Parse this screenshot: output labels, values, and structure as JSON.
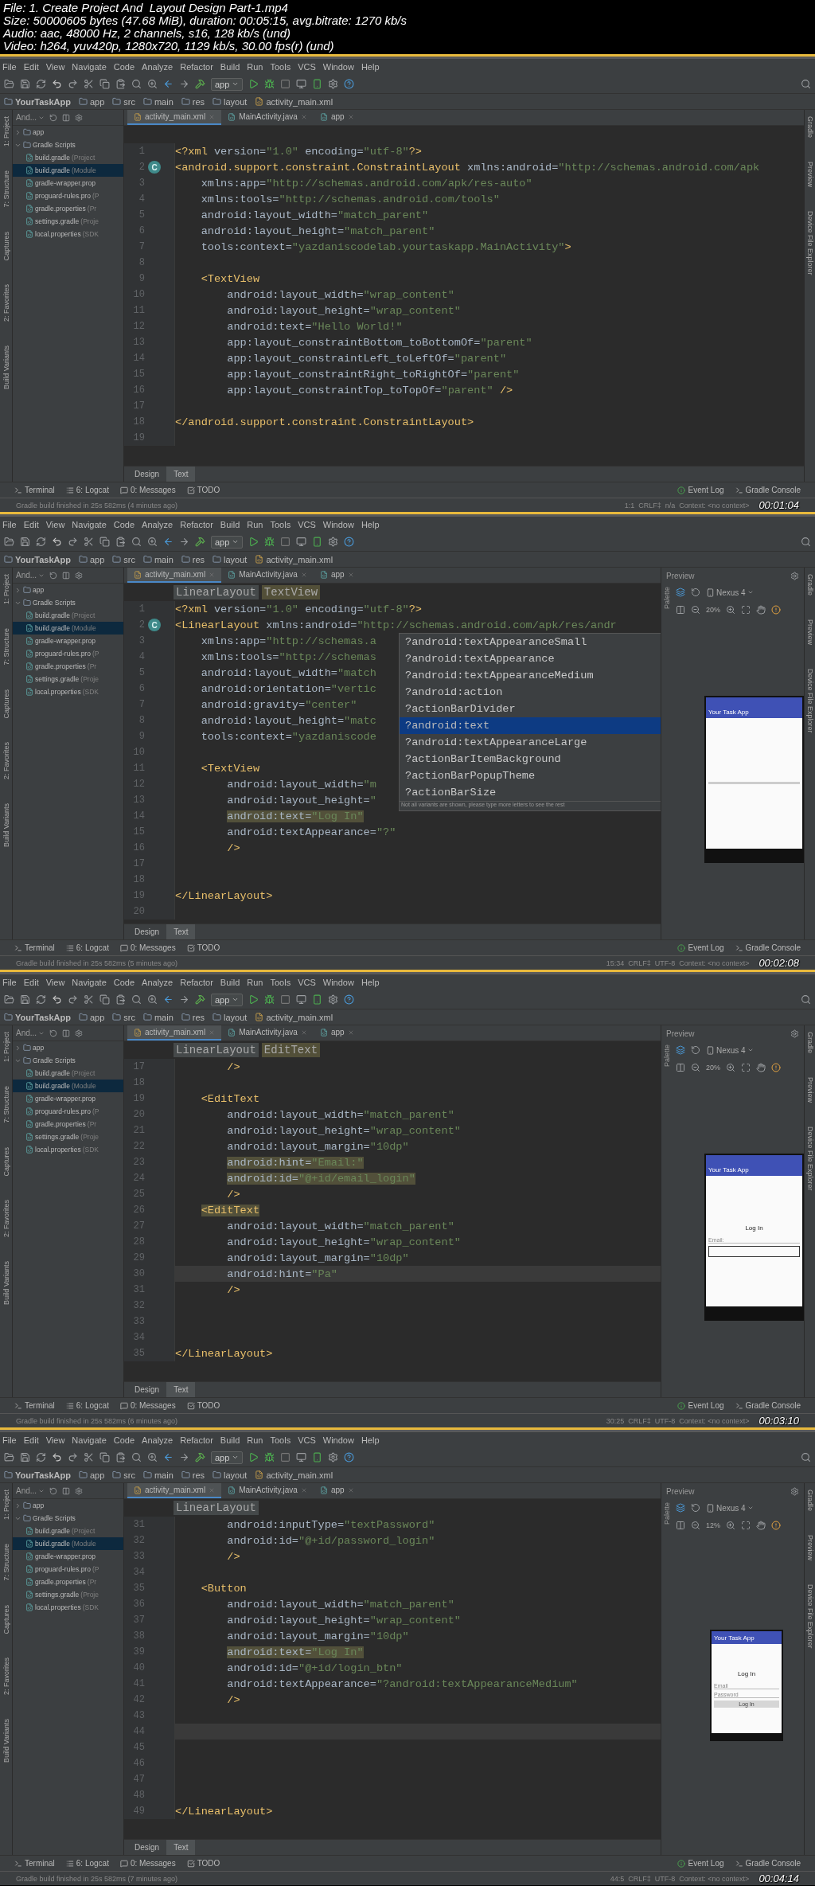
{
  "video_info": [
    "File: 1. Create Project And  Layout Design Part-1.mp4",
    "Size: 50000605 bytes (47.68 MiB), duration: 00:05:15, avg.bitrate: 1270 kb/s",
    "Audio: aac, 48000 Hz, 2 channels, s16, 128 kb/s (und)",
    "Video: h264, yuv420p, 1280x720, 1129 kb/s, 30.00 fps(r) (und)"
  ],
  "frames": [
    {
      "menu": [
        "File",
        "Edit",
        "View",
        "Navigate",
        "Code",
        "Analyze",
        "Refactor",
        "Build",
        "Run",
        "Tools",
        "VCS",
        "Window",
        "Help"
      ],
      "run_config": "app",
      "breadcrumb": [
        "YourTaskApp",
        "app",
        "src",
        "main",
        "res",
        "layout",
        "activity_main.xml"
      ],
      "left_tool_windows": [
        "1: Project",
        "7: Structure",
        "Captures",
        "2: Favorites",
        "Build Variants"
      ],
      "right_tool_windows": [
        "Gradle",
        "Preview",
        "Device File Explorer"
      ],
      "project": {
        "view": "And...",
        "tree": [
          {
            "label": "app",
            "expanded": false,
            "selected": false
          },
          {
            "label": "Gradle Scripts",
            "expanded": true,
            "selected": false,
            "children": [
              {
                "label": "build.gradle",
                "note": "(Project",
                "selected": false
              },
              {
                "label": "build.gradle",
                "note": "(Module",
                "selected": true
              },
              {
                "label": "gradle-wrapper.prop",
                "selected": false
              },
              {
                "label": "proguard-rules.pro",
                "note": "(P",
                "selected": false
              },
              {
                "label": "gradle.properties",
                "note": "(Pr",
                "selected": false
              },
              {
                "label": "settings.gradle",
                "note": "(Proje",
                "selected": false
              },
              {
                "label": "local.properties",
                "note": "(SDK",
                "selected": false
              }
            ]
          }
        ]
      },
      "editor_tabs": [
        {
          "label": "activity_main.xml",
          "selected": true
        },
        {
          "label": "MainActivity.java",
          "selected": false
        },
        {
          "label": "app",
          "selected": false
        }
      ],
      "code_lines": [
        {
          "n": "1",
          "text": "<?xml version=\"1.0\" encoding=\"utf-8\"?>"
        },
        {
          "n": "2",
          "text": "<android.support.constraint.ConstraintLayout xmlns:android=\"http://schemas.android.com/apk",
          "marker": "C"
        },
        {
          "n": "3",
          "text": "    xmlns:app=\"http://schemas.android.com/apk/res-auto\""
        },
        {
          "n": "4",
          "text": "    xmlns:tools=\"http://schemas.android.com/tools\""
        },
        {
          "n": "5",
          "text": "    android:layout_width=\"match_parent\""
        },
        {
          "n": "6",
          "text": "    android:layout_height=\"match_parent\""
        },
        {
          "n": "7",
          "text": "    tools:context=\"yazdaniscodelab.yourtaskapp.MainActivity\">"
        },
        {
          "n": "8"
        },
        {
          "n": "9",
          "text": "    <TextView"
        },
        {
          "n": "10",
          "text": "        android:layout_width=\"wrap_content\""
        },
        {
          "n": "11",
          "text": "        android:layout_height=\"wrap_content\""
        },
        {
          "n": "12",
          "text": "        android:text=\"Hello World!\""
        },
        {
          "n": "13",
          "text": "        app:layout_constraintBottom_toBottomOf=\"parent\""
        },
        {
          "n": "14",
          "text": "        app:layout_constraintLeft_toLeftOf=\"parent\""
        },
        {
          "n": "15",
          "text": "        app:layout_constraintRight_toRightOf=\"parent\""
        },
        {
          "n": "16",
          "text": "        app:layout_constraintTop_toTopOf=\"parent\" />"
        },
        {
          "n": "17"
        },
        {
          "n": "18",
          "text": "</android.support.constraint.ConstraintLayout>"
        },
        {
          "n": "19"
        }
      ],
      "design_tabs": [
        {
          "label": "Design",
          "selected": false
        },
        {
          "label": "Text",
          "selected": true
        }
      ],
      "bottom_tools": [
        "Terminal",
        "6: Logcat",
        "0: Messages",
        "TODO"
      ],
      "bottom_tools_right": [
        "Event Log",
        "Gradle Console"
      ],
      "status": "Gradle build finished in 25s 582ms (4 minutes ago)",
      "status_right": "1:1  CRLF‡  n/a  Context: <no context>",
      "timestamp": "00:01:04"
    },
    {
      "menu": [
        "File",
        "Edit",
        "View",
        "Navigate",
        "Code",
        "Analyze",
        "Refactor",
        "Build",
        "Run",
        "Tools",
        "VCS",
        "Window",
        "Help"
      ],
      "run_config": "app",
      "breadcrumb": [
        "YourTaskApp",
        "app",
        "src",
        "main",
        "res",
        "layout",
        "activity_main.xml"
      ],
      "left_tool_windows": [
        "1: Project",
        "7: Structure",
        "Captures",
        "2: Favorites",
        "Build Variants"
      ],
      "right_tool_windows": [
        "Gradle",
        "Preview",
        "Device File Explorer"
      ],
      "project": {
        "view": "And...",
        "tree": [
          {
            "label": "app",
            "expanded": false,
            "selected": false
          },
          {
            "label": "Gradle Scripts",
            "expanded": true,
            "selected": false,
            "children": [
              {
                "label": "build.gradle",
                "note": "(Project",
                "selected": false
              },
              {
                "label": "build.gradle",
                "note": "(Module",
                "selected": true
              },
              {
                "label": "gradle-wrapper.prop",
                "selected": false
              },
              {
                "label": "proguard-rules.pro",
                "note": "(P",
                "selected": false
              },
              {
                "label": "gradle.properties",
                "note": "(Pr",
                "selected": false
              },
              {
                "label": "settings.gradle",
                "note": "(Proje",
                "selected": false
              },
              {
                "label": "local.properties",
                "note": "(SDK",
                "selected": false
              }
            ]
          }
        ]
      },
      "editor_tabs": [
        {
          "label": "activity_main.xml",
          "selected": true
        },
        {
          "label": "MainActivity.java",
          "selected": false
        },
        {
          "label": "app",
          "selected": false
        }
      ],
      "element_path": [
        "LinearLayout",
        "TextView"
      ],
      "code_lines": [
        {
          "n": "1",
          "text": "<?xml version=\"1.0\" encoding=\"utf-8\"?>"
        },
        {
          "n": "2",
          "text": "<LinearLayout xmlns:android=\"http://schemas.android.com/apk/res/andr",
          "marker": "C"
        },
        {
          "n": "3",
          "text": "    xmlns:app=\"http://schemas.a"
        },
        {
          "n": "4",
          "text": "    xmlns:tools=\"http://schemas"
        },
        {
          "n": "5",
          "text": "    android:layout_width=\"match"
        },
        {
          "n": "6",
          "text": "    android:orientation=\"vertic"
        },
        {
          "n": "7",
          "text": "    android:gravity=\"center\""
        },
        {
          "n": "8",
          "text": "    android:layout_height=\"matc"
        },
        {
          "n": "9",
          "text": "    tools:context=\"yazdaniscode"
        },
        {
          "n": "10"
        },
        {
          "n": "11",
          "text": "    <TextView"
        },
        {
          "n": "12",
          "text": "        android:layout_width=\"m"
        },
        {
          "n": "13",
          "text": "        android:layout_height=\""
        },
        {
          "n": "14",
          "text": "        android:text=\"Log In\"",
          "highlighted": true
        },
        {
          "n": "15",
          "text": "        android:textAppearance=\"?\""
        },
        {
          "n": "16",
          "text": "        />"
        },
        {
          "n": "17"
        },
        {
          "n": "18"
        },
        {
          "n": "19",
          "text": "</LinearLayout>"
        },
        {
          "n": "20"
        }
      ],
      "completion": {
        "items": [
          {
            "label": "?android:textAppearanceSmall",
            "selected": false
          },
          {
            "label": "?android:textAppearance",
            "selected": false
          },
          {
            "label": "?android:textAppearanceMedium",
            "selected": false
          },
          {
            "label": "?android:action",
            "selected": false
          },
          {
            "label": "?actionBarDivider",
            "selected": false
          },
          {
            "label": "?android:text",
            "selected": true
          },
          {
            "label": "?android:textAppearanceLarge",
            "selected": false
          },
          {
            "label": "?actionBarItemBackground",
            "selected": false
          },
          {
            "label": "?actionBarPopupTheme",
            "selected": false
          },
          {
            "label": "?actionBarSize",
            "selected": false
          }
        ],
        "footer": "Not all variants are shown, please type more letters to see the rest"
      },
      "preview": {
        "title": "Preview",
        "side_tab": "Palette",
        "device": "Nexus 4",
        "zoom": "20%",
        "phone": {
          "compact": false,
          "app_title": "Your Task App",
          "content": [
            {
              "kind": "divider"
            }
          ]
        }
      },
      "design_tabs": [
        {
          "label": "Design",
          "selected": false
        },
        {
          "label": "Text",
          "selected": true
        }
      ],
      "bottom_tools": [
        "Terminal",
        "6: Logcat",
        "0: Messages",
        "TODO"
      ],
      "bottom_tools_right": [
        "Event Log",
        "Gradle Console"
      ],
      "status": "Gradle build finished in 25s 582ms (5 minutes ago)",
      "status_right": "15:34  CRLF‡  UTF-8  Context: <no context>",
      "timestamp": "00:02:08"
    },
    {
      "menu": [
        "File",
        "Edit",
        "View",
        "Navigate",
        "Code",
        "Analyze",
        "Refactor",
        "Build",
        "Run",
        "Tools",
        "VCS",
        "Window",
        "Help"
      ],
      "run_config": "app",
      "breadcrumb": [
        "YourTaskApp",
        "app",
        "src",
        "main",
        "res",
        "layout",
        "activity_main.xml"
      ],
      "left_tool_windows": [
        "1: Project",
        "7: Structure",
        "Captures",
        "2: Favorites",
        "Build Variants"
      ],
      "right_tool_windows": [
        "Gradle",
        "Preview",
        "Device File Explorer"
      ],
      "project": {
        "view": "And...",
        "tree": [
          {
            "label": "app",
            "expanded": false,
            "selected": false
          },
          {
            "label": "Gradle Scripts",
            "expanded": true,
            "selected": false,
            "children": [
              {
                "label": "build.gradle",
                "note": "(Project",
                "selected": false
              },
              {
                "label": "build.gradle",
                "note": "(Module",
                "selected": true
              },
              {
                "label": "gradle-wrapper.prop",
                "selected": false
              },
              {
                "label": "proguard-rules.pro",
                "note": "(P",
                "selected": false
              },
              {
                "label": "gradle.properties",
                "note": "(Pr",
                "selected": false
              },
              {
                "label": "settings.gradle",
                "note": "(Proje",
                "selected": false
              },
              {
                "label": "local.properties",
                "note": "(SDK",
                "selected": false
              }
            ]
          }
        ]
      },
      "editor_tabs": [
        {
          "label": "activity_main.xml",
          "selected": true
        },
        {
          "label": "MainActivity.java",
          "selected": false
        },
        {
          "label": "app",
          "selected": false
        }
      ],
      "element_path": [
        "LinearLayout",
        "EditText"
      ],
      "code_lines": [
        {
          "n": "17",
          "text": "        />"
        },
        {
          "n": "18"
        },
        {
          "n": "19",
          "text": "    <EditText"
        },
        {
          "n": "20",
          "text": "        android:layout_width=\"match_parent\""
        },
        {
          "n": "21",
          "text": "        android:layout_height=\"wrap_content\""
        },
        {
          "n": "22",
          "text": "        android:layout_margin=\"10dp\""
        },
        {
          "n": "23",
          "text": "        android:hint=\"Email:\"",
          "highlighted": true
        },
        {
          "n": "24",
          "text": "        android:id=\"@+id/email_login\"",
          "highlighted": true
        },
        {
          "n": "25",
          "text": "        />"
        },
        {
          "n": "26",
          "text": "    <EditText",
          "highlighted": true
        },
        {
          "n": "27",
          "text": "        android:layout_width=\"match_parent\""
        },
        {
          "n": "28",
          "text": "        android:layout_height=\"wrap_content\""
        },
        {
          "n": "29",
          "text": "        android:layout_margin=\"10dp\""
        },
        {
          "n": "30",
          "text": "        android:hint=\"Pa\"",
          "current": true
        },
        {
          "n": "31",
          "text": "        />"
        },
        {
          "n": "32"
        },
        {
          "n": "33"
        },
        {
          "n": "34"
        },
        {
          "n": "35",
          "text": "</LinearLayout>"
        }
      ],
      "preview": {
        "title": "Preview",
        "side_tab": "Palette",
        "device": "Nexus 4",
        "zoom": "20%",
        "phone": {
          "compact": false,
          "app_title": "Your Task App",
          "content": [
            {
              "kind": "title",
              "text": "Log In"
            },
            {
              "kind": "hint",
              "text": "Email:"
            },
            {
              "kind": "field",
              "focused": true
            }
          ]
        }
      },
      "design_tabs": [
        {
          "label": "Design",
          "selected": false
        },
        {
          "label": "Text",
          "selected": true
        }
      ],
      "bottom_tools": [
        "Terminal",
        "6: Logcat",
        "0: Messages",
        "TODO"
      ],
      "bottom_tools_right": [
        "Event Log",
        "Gradle Console"
      ],
      "status": "Gradle build finished in 25s 582ms (6 minutes ago)",
      "status_right": "30:25  CRLF‡  UTF-8  Context: <no context>",
      "timestamp": "00:03:10"
    },
    {
      "menu": [
        "File",
        "Edit",
        "View",
        "Navigate",
        "Code",
        "Analyze",
        "Refactor",
        "Build",
        "Run",
        "Tools",
        "VCS",
        "Window",
        "Help"
      ],
      "run_config": "app",
      "breadcrumb": [
        "YourTaskApp",
        "app",
        "src",
        "main",
        "res",
        "layout",
        "activity_main.xml"
      ],
      "left_tool_windows": [
        "1: Project",
        "7: Structure",
        "Captures",
        "2: Favorites",
        "Build Variants"
      ],
      "right_tool_windows": [
        "Gradle",
        "Preview",
        "Device File Explorer"
      ],
      "project": {
        "view": "And...",
        "tree": [
          {
            "label": "app",
            "expanded": false,
            "selected": false
          },
          {
            "label": "Gradle Scripts",
            "expanded": true,
            "selected": false,
            "children": [
              {
                "label": "build.gradle",
                "note": "(Project",
                "selected": false
              },
              {
                "label": "build.gradle",
                "note": "(Module",
                "selected": true
              },
              {
                "label": "gradle-wrapper.prop",
                "selected": false
              },
              {
                "label": "proguard-rules.pro",
                "note": "(P",
                "selected": false
              },
              {
                "label": "gradle.properties",
                "note": "(Pr",
                "selected": false
              },
              {
                "label": "settings.gradle",
                "note": "(Proje",
                "selected": false
              },
              {
                "label": "local.properties",
                "note": "(SDK",
                "selected": false
              }
            ]
          }
        ]
      },
      "editor_tabs": [
        {
          "label": "activity_main.xml",
          "selected": true
        },
        {
          "label": "MainActivity.java",
          "selected": false
        },
        {
          "label": "app",
          "selected": false
        }
      ],
      "element_path": [
        "LinearLayout"
      ],
      "code_lines": [
        {
          "n": "31",
          "text": "        android:inputType=\"textPassword\""
        },
        {
          "n": "32",
          "text": "        android:id=\"@+id/password_login\""
        },
        {
          "n": "33",
          "text": "        />"
        },
        {
          "n": "34"
        },
        {
          "n": "35",
          "text": "    <Button"
        },
        {
          "n": "36",
          "text": "        android:layout_width=\"match_parent\""
        },
        {
          "n": "37",
          "text": "        android:layout_height=\"wrap_content\""
        },
        {
          "n": "38",
          "text": "        android:layout_margin=\"10dp\""
        },
        {
          "n": "39",
          "text": "        android:text=\"Log In\"",
          "highlighted": true
        },
        {
          "n": "40",
          "text": "        android:id=\"@+id/login_btn\""
        },
        {
          "n": "41",
          "text": "        android:textAppearance=\"?android:textAppearanceMedium\""
        },
        {
          "n": "42",
          "text": "        />"
        },
        {
          "n": "43"
        },
        {
          "n": "44",
          "current": true
        },
        {
          "n": "45"
        },
        {
          "n": "46"
        },
        {
          "n": "47"
        },
        {
          "n": "48"
        },
        {
          "n": "49",
          "text": "</LinearLayout>"
        }
      ],
      "preview": {
        "title": "Preview",
        "side_tab": "Palette",
        "device": "Nexus 4",
        "zoom": "12%",
        "phone": {
          "compact": true,
          "app_title": "Your Task App",
          "content": [
            {
              "kind": "title",
              "text": "Log In"
            },
            {
              "kind": "hint",
              "text": "Email"
            },
            {
              "kind": "hint",
              "text": "Password"
            },
            {
              "kind": "button",
              "text": "Log In"
            }
          ]
        }
      },
      "design_tabs": [
        {
          "label": "Design",
          "selected": false
        },
        {
          "label": "Text",
          "selected": true
        }
      ],
      "bottom_tools": [
        "Terminal",
        "6: Logcat",
        "0: Messages",
        "TODO"
      ],
      "bottom_tools_right": [
        "Event Log",
        "Gradle Console"
      ],
      "status": "Gradle build finished in 25s 582ms (7 minutes ago)",
      "status_right": "44:5  CRLF‡  UTF-8  Context: <no context>",
      "timestamp": "00:04:14"
    }
  ]
}
